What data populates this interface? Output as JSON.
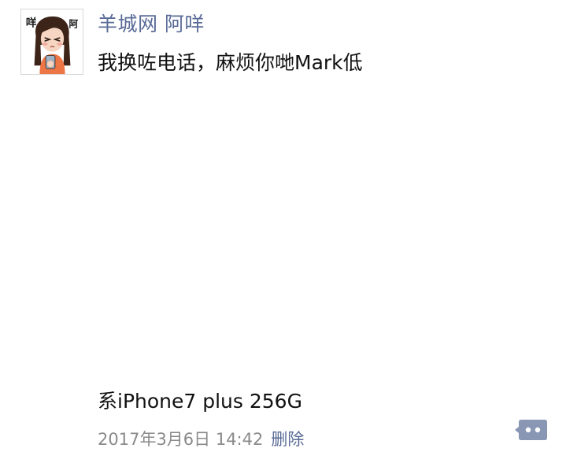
{
  "post": {
    "author": "羊城网 阿咩",
    "content": "我换咗电话，麻烦你哋Mark低",
    "caption": "系iPhone7 plus 256G",
    "timestamp": "2017年3月6日 14:42",
    "delete_label": "删除"
  },
  "avatar": {
    "text_left": "咩",
    "text_right": "阿"
  },
  "icons": {
    "avatar": "cartoon-girl-avatar",
    "comment": "comment-more-icon"
  },
  "colors": {
    "author_name": "#5a6b97",
    "body_text": "#111111",
    "meta_text": "#8a8a8a",
    "comment_button": "#8a97b4"
  }
}
